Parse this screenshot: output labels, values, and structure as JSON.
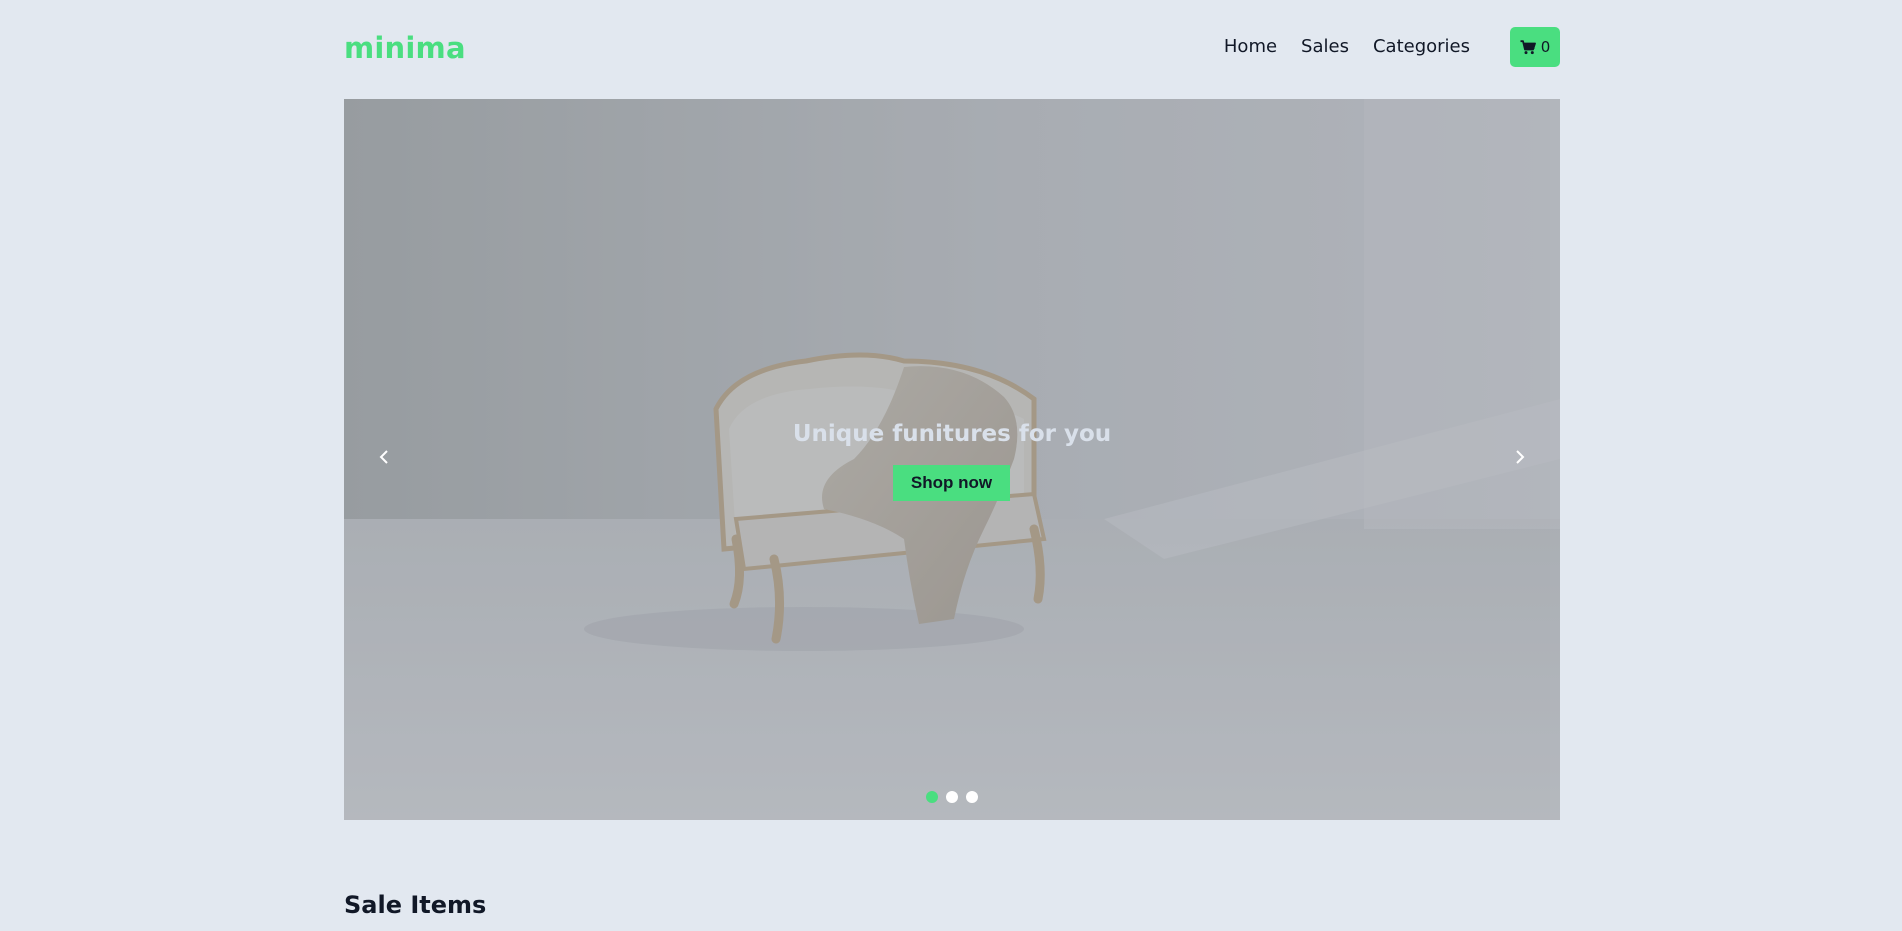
{
  "brand": {
    "logo": "minima",
    "accent": "#4ade80"
  },
  "nav": {
    "links": [
      "Home",
      "Sales",
      "Categories"
    ],
    "cart_count": "0",
    "cart_icon": "shopping-cart-icon"
  },
  "hero": {
    "title": "Unique funitures for you",
    "button_label": "Shop now",
    "prev_icon": "chevron-left-icon",
    "next_icon": "chevron-right-icon",
    "slide_count": 3,
    "active_slide": 1
  },
  "sections": {
    "sale_title": "Sale Items"
  }
}
